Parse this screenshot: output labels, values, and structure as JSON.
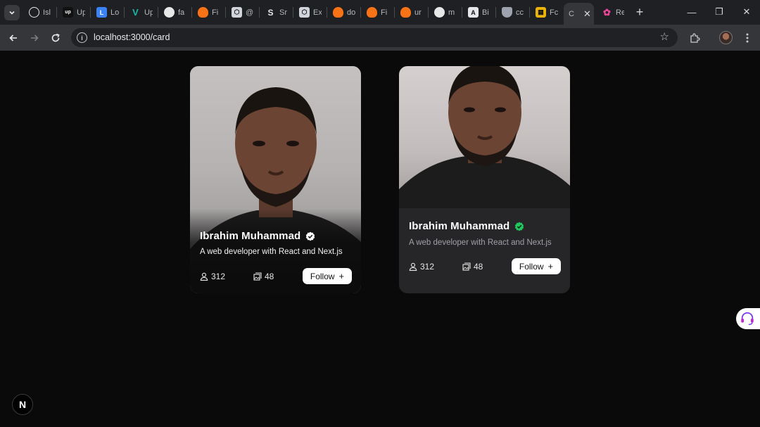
{
  "browser": {
    "tabs": [
      {
        "label": "Isl",
        "color": "#e8e8e8",
        "glyph": "P"
      },
      {
        "label": "Up",
        "color": "#111111",
        "glyph": "up"
      },
      {
        "label": "Lo",
        "color": "#3b82f6",
        "glyph": "L"
      },
      {
        "label": "Up",
        "color": "#14b8a6",
        "glyph": "V"
      },
      {
        "label": "fa",
        "color": "#1f2023",
        "glyph": "gh"
      },
      {
        "label": "Fi",
        "color": "#f97316",
        "glyph": "F"
      },
      {
        "label": "@",
        "color": "#d1d5db",
        "glyph": "C"
      },
      {
        "label": "Sr",
        "color": "#d1d5db",
        "glyph": "S"
      },
      {
        "label": "Ex",
        "color": "#d1d5db",
        "glyph": "C"
      },
      {
        "label": "do",
        "color": "#f97316",
        "glyph": "F"
      },
      {
        "label": "Fi",
        "color": "#f97316",
        "glyph": "F"
      },
      {
        "label": "ur",
        "color": "#f97316",
        "glyph": "F"
      },
      {
        "label": "m",
        "color": "#1f2023",
        "glyph": "gh"
      },
      {
        "label": "Bi",
        "color": "#e5e7eb",
        "glyph": "A"
      },
      {
        "label": "cc",
        "color": "#9ca3af",
        "glyph": "N"
      },
      {
        "label": "Fc",
        "color": "#eab308",
        "glyph": "▦"
      },
      {
        "label": "C",
        "color": "#2e2f33",
        "glyph": ""
      },
      {
        "label": "Re",
        "color": "#ec4899",
        "glyph": "✿"
      }
    ],
    "url": "localhost:3000/card"
  },
  "cards": [
    {
      "name": "Ibrahim Muhammad",
      "bio": "A web developer with React and Next.js",
      "followers": "312",
      "posts": "48",
      "follow_label": "Follow",
      "badge_color": "#ffffff"
    },
    {
      "name": "Ibrahim Muhammad",
      "bio": "A web developer with React and Next.js",
      "followers": "312",
      "posts": "48",
      "follow_label": "Follow",
      "badge_color": "#22c55e"
    }
  ],
  "next_badge": "N"
}
